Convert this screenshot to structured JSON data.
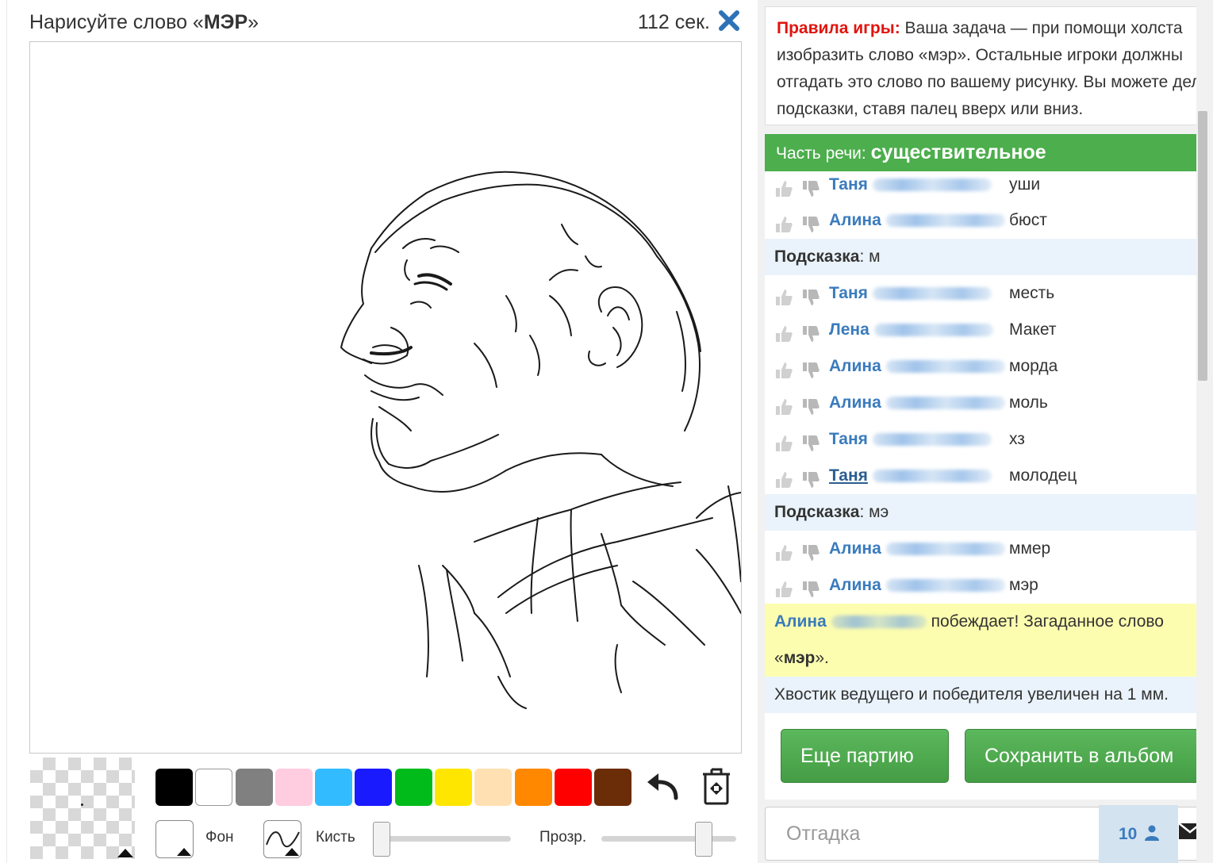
{
  "header": {
    "prompt_prefix": "Нарисуйте слово «",
    "prompt_word": "МЭР",
    "prompt_suffix": "»",
    "timer": "112 сек.",
    "close_icon": "close-x-icon"
  },
  "canvas": {
    "content": "line drawing of a bald man in profile"
  },
  "toolbar": {
    "colors": [
      "#000000",
      "#ffffff",
      "#808080",
      "#ffcce0",
      "#33bbff",
      "#1a1aff",
      "#00bb1a",
      "#ffe600",
      "#ffe0b2",
      "#ff8800",
      "#ff0000",
      "#6b2c08"
    ],
    "undo_icon": "undo-arrow-icon",
    "clear_icon": "clear-canvas-icon",
    "background_label": "Фон",
    "brush_label": "Кисть",
    "opacity_label": "Прозр.",
    "brush_size_fraction": 0.0,
    "opacity_fraction": 0.8
  },
  "rules": {
    "label": "Правила игры:",
    "text": "Ваша задача — при помощи холста изобразить слово «мэр». Остальные игроки должны отгадать это слово по вашему рисунку. Вы можете делать подсказки, ставя палец вверх или вниз."
  },
  "part_of_speech": {
    "label": "Часть речи:",
    "value": "существительное"
  },
  "chat": {
    "messages": [
      {
        "name": "Таня",
        "word": "уши"
      },
      {
        "name": "Алина",
        "word": "бюст"
      },
      {
        "name": "Таня",
        "word": "месть"
      },
      {
        "name": "Лена",
        "word": "Макет"
      },
      {
        "name": "Алина",
        "word": "морда"
      },
      {
        "name": "Алина",
        "word": "моль"
      },
      {
        "name": "Таня",
        "word": "хз"
      },
      {
        "name": "Таня",
        "word": "молодец"
      },
      {
        "name": "Алина",
        "word": "ммер"
      },
      {
        "name": "Алина",
        "word": "мэр"
      }
    ],
    "hint_label": "Подсказка",
    "hint1": "м",
    "hint2": "мэ",
    "winner_name": "Алина",
    "winner_text": "побеждает! Загаданное слово",
    "winner_word_prefix": "«",
    "winner_word": "мэр",
    "winner_word_suffix": "».",
    "tail_info": "Хвостик ведущего и победителя увеличен на 1 мм."
  },
  "buttons": {
    "next_game": "Еще партию",
    "save_album": "Сохранить в альбом"
  },
  "answer": {
    "placeholder": "Отгадка",
    "players_count": "10",
    "players_icon": "person-icon",
    "send_icon": "send-envelope-icon"
  }
}
